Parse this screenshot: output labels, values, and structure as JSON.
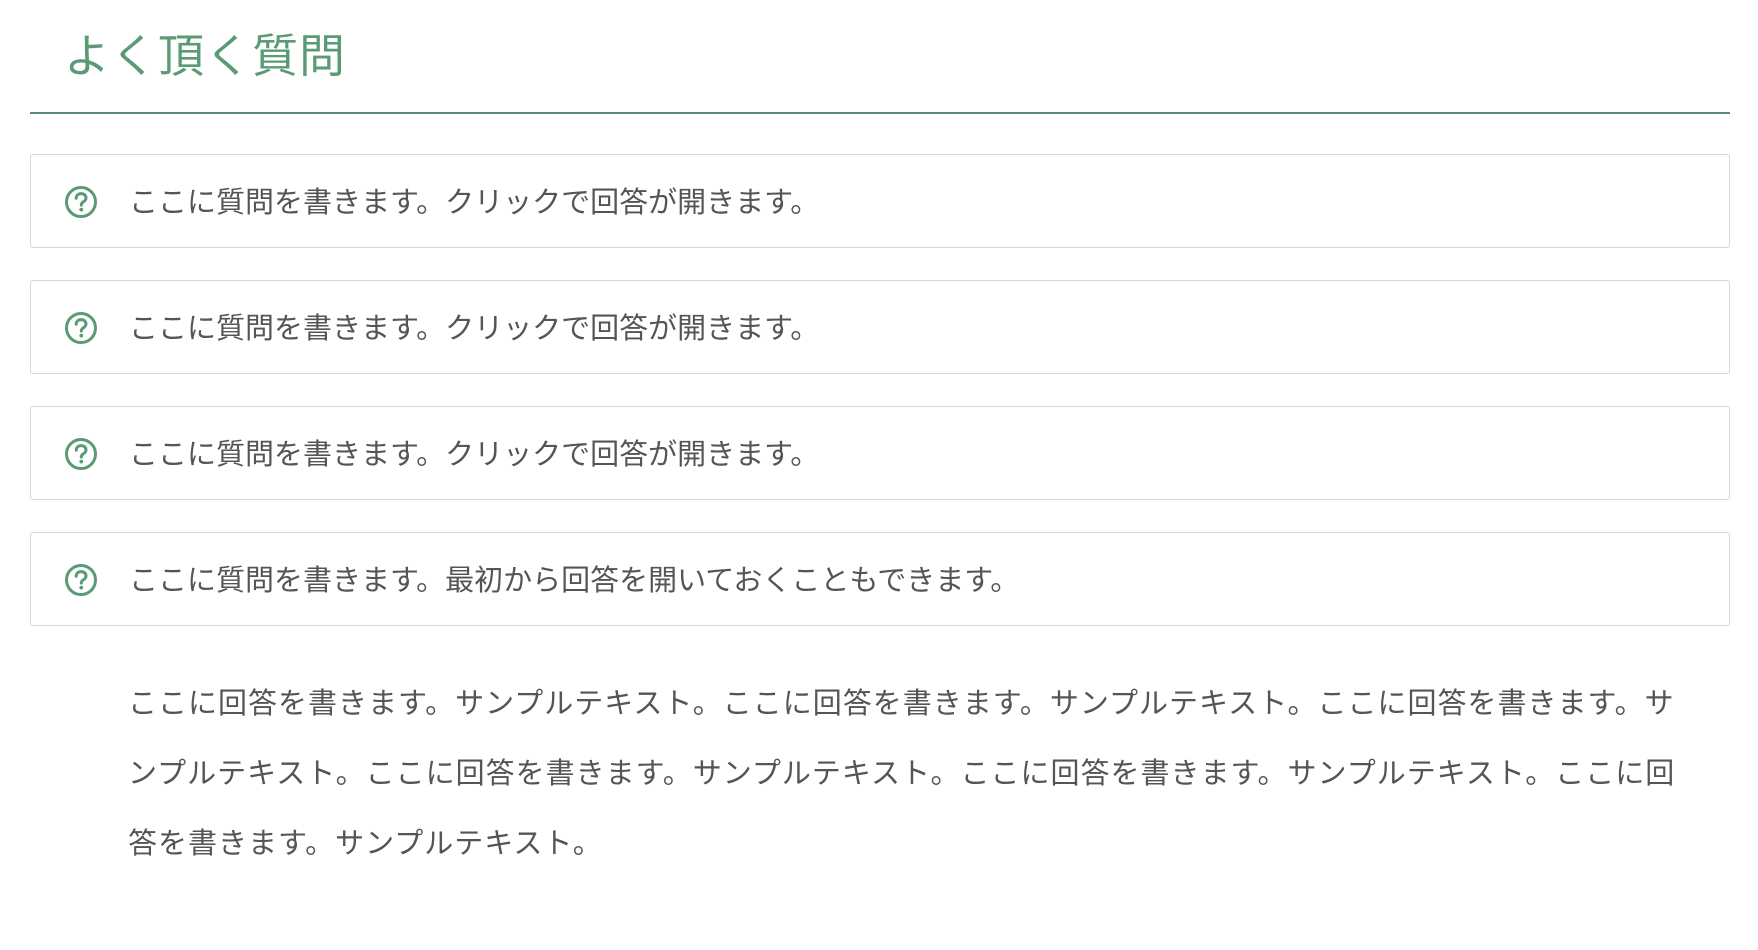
{
  "page": {
    "title": "よく頂く質問"
  },
  "faq": {
    "items": [
      {
        "question": "ここに質問を書きます。クリックで回答が開きます。"
      },
      {
        "question": "ここに質問を書きます。クリックで回答が開きます。"
      },
      {
        "question": "ここに質問を書きます。クリックで回答が開きます。"
      },
      {
        "question": "ここに質問を書きます。最初から回答を開いておくこともできます。"
      }
    ],
    "answer": "ここに回答を書きます。サンプルテキスト。ここに回答を書きます。サンプルテキスト。ここに回答を書きます。サンプルテキスト。ここに回答を書きます。サンプルテキスト。ここに回答を書きます。サンプルテキスト。ここに回答を書きます。サンプルテキスト。",
    "icon": "question-circle-icon",
    "accent_color": "#5a9a74",
    "border_color": "#d6d6d6"
  }
}
